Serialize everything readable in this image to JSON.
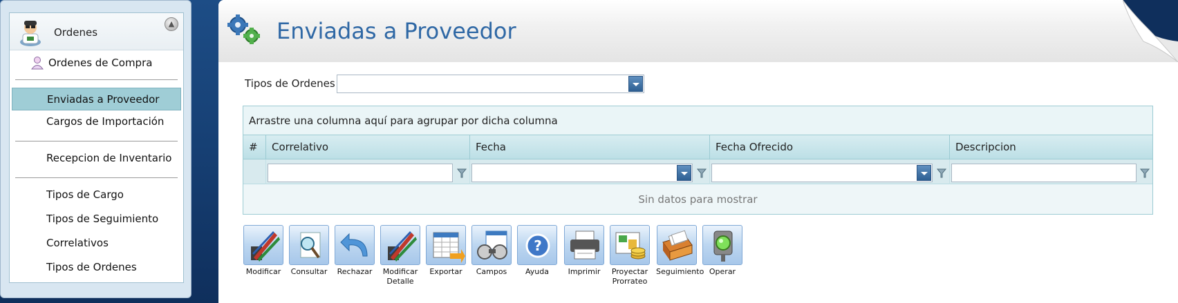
{
  "sidebar": {
    "header_title": "Ordenes",
    "items": [
      {
        "label": "Ordenes de Compra"
      },
      {
        "label": "Enviadas a Proveedor"
      },
      {
        "label": "Cargos de Importación"
      },
      {
        "label": "Recepcion de Inventario"
      },
      {
        "label": "Tipos de Cargo"
      },
      {
        "label": "Tipos de Seguimiento"
      },
      {
        "label": "Correlativos"
      },
      {
        "label": "Tipos de Ordenes"
      }
    ]
  },
  "page": {
    "title": "Enviadas a Proveedor",
    "filter_label": "Tipos de Ordenes",
    "filter_value": ""
  },
  "grid": {
    "group_hint": "Arrastre una columna aquí para agrupar por dicha columna",
    "columns": [
      "#",
      "Correlativo",
      "Fecha",
      "Fecha Ofrecido",
      "Descripcion"
    ],
    "empty_text": "Sin datos para mostrar"
  },
  "toolbar": {
    "buttons": [
      {
        "label": "Modificar",
        "icon": "edit-pencils-icon"
      },
      {
        "label": "Consultar",
        "icon": "magnifier-document-icon"
      },
      {
        "label": "Rechazar",
        "icon": "undo-arrow-icon"
      },
      {
        "label": "Modificar Detalle",
        "icon": "edit-detail-icon"
      },
      {
        "label": "Exportar",
        "icon": "export-spreadsheet-icon"
      },
      {
        "label": "Campos",
        "icon": "columns-grid-icon"
      },
      {
        "label": "Ayuda",
        "icon": "help-icon"
      },
      {
        "label": "Imprimir",
        "icon": "printer-icon"
      },
      {
        "label": "Proyectar Prorrateo",
        "icon": "projection-coins-icon"
      },
      {
        "label": "Seguimiento",
        "icon": "card-file-icon"
      },
      {
        "label": "Operar",
        "icon": "traffic-light-icon"
      }
    ]
  }
}
